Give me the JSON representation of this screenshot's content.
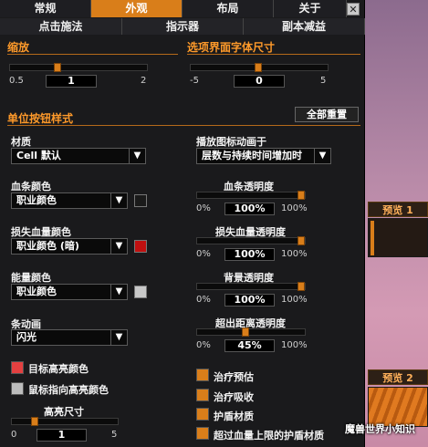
{
  "tabs": [
    "常规",
    "外观",
    "布局",
    "关于"
  ],
  "active_tab": "外观",
  "close_label": "✕",
  "subtabs": [
    "点击施法",
    "指示器",
    "副本减益"
  ],
  "scale": {
    "title": "缩放",
    "min": "0.5",
    "max": "2",
    "value": "1"
  },
  "font_size": {
    "title": "选项界面字体尺寸",
    "min": "-5",
    "max": "5",
    "value": "0"
  },
  "unit_style": {
    "title": "单位按钮样式",
    "reset_label": "全部重置"
  },
  "texture": {
    "label": "材质",
    "value": "Cell 默认"
  },
  "health_color": {
    "label": "血条颜色",
    "value": "职业颜色",
    "swatch": "#1a1a1a"
  },
  "lost_health_color": {
    "label": "损失血量颜色",
    "value": "职业颜色 (暗)",
    "swatch": "#c01010"
  },
  "power_color": {
    "label": "能量颜色",
    "value": "职业颜色",
    "swatch": "#c8c8c8"
  },
  "bar_animation": {
    "label": "条动画",
    "value": "闪光"
  },
  "icon_animation": {
    "label": "播放图标动画于",
    "value": "层数与持续时间增加时"
  },
  "alphas": [
    {
      "label": "血条透明度",
      "min": "0%",
      "max": "100%",
      "value": "100%",
      "fraction": 1.0
    },
    {
      "label": "损失血量透明度",
      "min": "0%",
      "max": "100%",
      "value": "100%",
      "fraction": 1.0
    },
    {
      "label": "背景透明度",
      "min": "0%",
      "max": "100%",
      "value": "100%",
      "fraction": 1.0
    },
    {
      "label": "超出距离透明度",
      "min": "0%",
      "max": "100%",
      "value": "45%",
      "fraction": 0.45
    }
  ],
  "highlight": {
    "target_label": "目标高亮颜色",
    "mouseover_label": "鼠标指向高亮颜色",
    "size_label": "高亮尺寸",
    "min": "0",
    "max": "5",
    "value": "1"
  },
  "toggles": [
    "治疗预估",
    "治疗吸收",
    "护盾材质",
    "超过血量上限的护盾材质"
  ],
  "previews": [
    "预览 1",
    "预览 2"
  ],
  "watermark": "魔兽世界小知识",
  "colors": {
    "accent": "#d97e1a",
    "section": "#ff9a2a"
  }
}
